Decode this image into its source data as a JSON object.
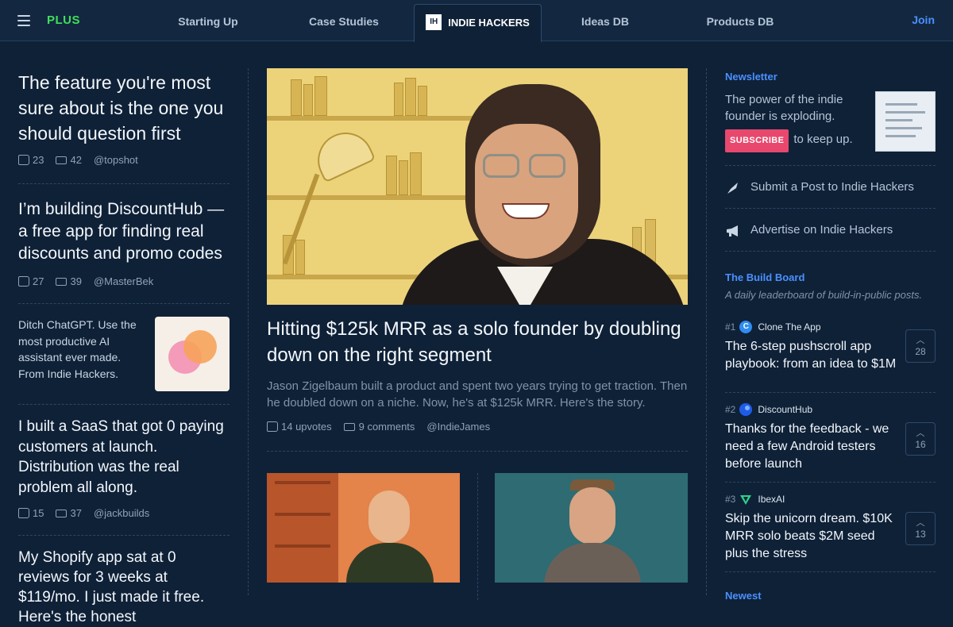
{
  "nav": {
    "brand": "PLUS",
    "tabs": [
      "Starting Up",
      "Case Studies",
      "INDIE HACKERS",
      "Ideas DB",
      "Products DB"
    ],
    "active_logo": "IH",
    "join": "Join"
  },
  "left_posts": [
    {
      "title": "The feature you're most sure about is the one you should question first",
      "upvotes": "23",
      "comments": "42",
      "author": "@topshot"
    },
    {
      "title": "I’m building DiscountHub — a free app for finding real discounts and promo codes",
      "upvotes": "27",
      "comments": "39",
      "author": "@MasterBek"
    },
    {
      "title": "I built a SaaS that got 0 paying customers at launch. Distribution was the real problem all along.",
      "upvotes": "15",
      "comments": "37",
      "author": "@jackbuilds"
    },
    {
      "title": "My Shopify app sat at 0 reviews for 3 weeks at $119/mo. I just made it free. Here's the honest"
    }
  ],
  "left_ad": {
    "text": "Ditch ChatGPT. Use the most productive AI assistant ever made. From Indie Hackers."
  },
  "featured": {
    "title": "Hitting $125k MRR as a solo founder by doubling down on the right segment",
    "description": "Jason Zigelbaum built a product and spent two years trying to get traction. Then he doubled down on a niche. Now, he's at $125k MRR. Here's the story.",
    "upvotes": "14 upvotes",
    "comments": "9 comments",
    "author": "@IndieJames"
  },
  "newsletter": {
    "heading": "Newsletter",
    "text": "The power of the indie founder is exploding.",
    "button": "SUBSCRIBE",
    "tail": "to keep up."
  },
  "links": {
    "submit": "Submit a Post to Indie Hackers",
    "advertise": "Advertise on Indie Hackers"
  },
  "build_board": {
    "heading": "The Build Board",
    "subtitle": "A daily leaderboard of build-in-public posts.",
    "items": [
      {
        "rank": "#1",
        "app": "Clone The App",
        "logo": "C",
        "logo_color": "#2f8cf0",
        "title": "The 6-step pushscroll app playbook: from an idea to $1M",
        "votes": "28"
      },
      {
        "rank": "#2",
        "app": "DiscountHub",
        "logo": "",
        "logo_color": "#1e5be8",
        "title": "Thanks for the feedback - we need a few Android testers before launch",
        "votes": "16"
      },
      {
        "rank": "#3",
        "app": "IbexAI",
        "logo": "",
        "logo_color": "#2fd08a",
        "title": "Skip the unicorn dream. $10K MRR solo beats $2M seed plus the stress",
        "votes": "13"
      }
    ]
  },
  "newest": {
    "heading": "Newest"
  }
}
